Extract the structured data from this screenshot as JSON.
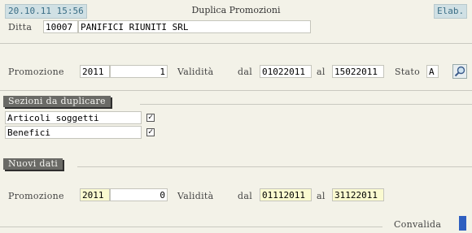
{
  "header": {
    "datetime": "20.10.11 15:56",
    "title": "Duplica Promozioni",
    "elab": "Elab."
  },
  "ditta": {
    "label": "Ditta",
    "code": "10007",
    "name": "PANIFICI RIUNITI SRL"
  },
  "promozione": {
    "label": "Promozione",
    "year": "2011",
    "number": "1",
    "validita_label": "Validità",
    "dal_label": "dal",
    "dal": "01022011",
    "al_label": "al",
    "al": "15022011",
    "stato_label": "Stato",
    "stato": "A"
  },
  "sezioni": {
    "title": "Sezioni da duplicare",
    "items": [
      {
        "label": "Articoli soggetti",
        "checked": "✓"
      },
      {
        "label": "Benefici",
        "checked": "✓"
      }
    ]
  },
  "nuovi": {
    "title": "Nuovi dati",
    "label": "Promozione",
    "year": "2011",
    "number": "0",
    "validita_label": "Validità",
    "dal_label": "dal",
    "dal": "01112011",
    "al_label": "al",
    "al": "31122011"
  },
  "footer": {
    "convalida": "Convalida"
  },
  "colors": {
    "background": "#f3f2e8",
    "section_header": "#6a6a66",
    "highlight_input": "#fafad0",
    "confirm": "#2f5fc0"
  }
}
